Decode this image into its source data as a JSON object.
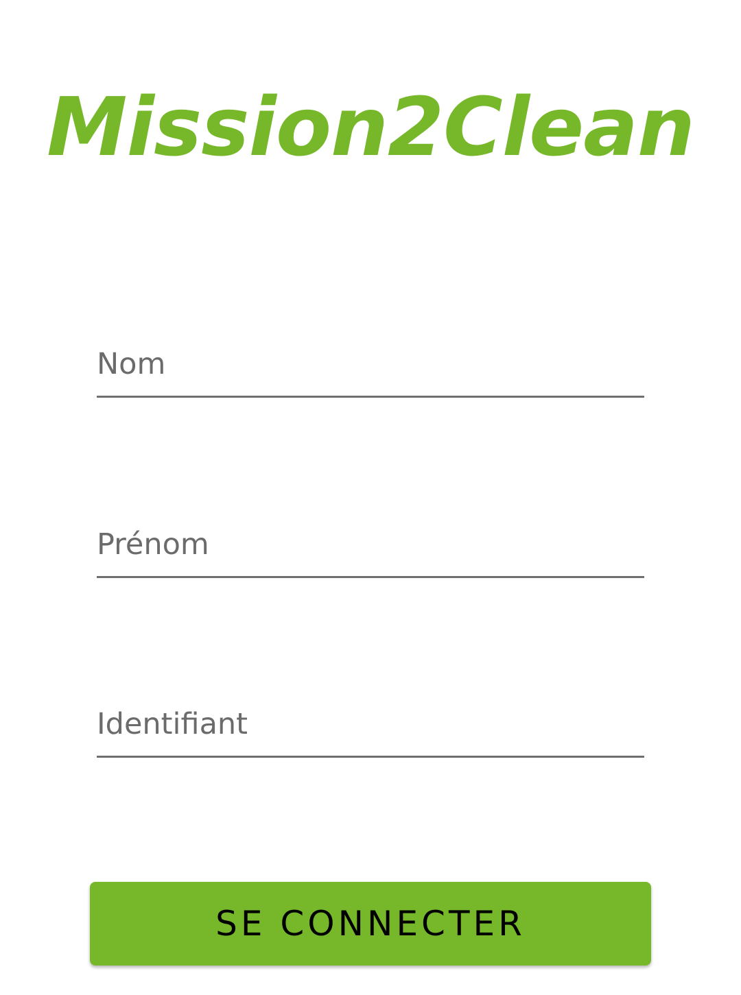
{
  "app": {
    "logo_text": "Mission2Clean"
  },
  "form": {
    "nom": {
      "placeholder": "Nom",
      "value": ""
    },
    "prenom": {
      "placeholder": "Prénom",
      "value": ""
    },
    "identifiant": {
      "placeholder": "Identifiant",
      "value": ""
    },
    "submit_label": "SE CONNECTER"
  },
  "colors": {
    "brand_green": "#77b82a",
    "underline": "#6f6f6f",
    "placeholder": "#6b6b6b"
  }
}
